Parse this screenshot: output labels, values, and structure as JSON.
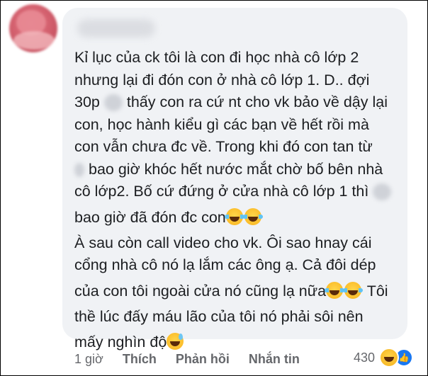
{
  "comment": {
    "lines": [
      "Kỉ lục của ck tôi là con đi học nhà cô lớp 2",
      "nhưng lại đi đón con ở nhà cô lớp 1. D.. đợi",
      "30p",
      "thấy con ra cứ nt cho vk bảo về dậy lại",
      "con, học hành kiểu gì các bạn về hết rồi mà",
      "con vẫn chưa đc về. Trong khi đó con tan từ",
      "bao giờ khóc hết nước mắt chờ bố bên nhà",
      "cô lớp2. Bố cứ đứng ở cửa nhà cô lớp 1 thì",
      "bao giờ đã đón đc con",
      "À sau còn call video cho vk. Ôi sao hnay cái",
      "cổng nhà cô nó lạ lắm các ông ạ. Cả đôi dép",
      "của con tôi ngoài cửa nó cũng lạ nữa",
      "Tôi",
      "thề lúc đấy máu lão của tôi nó phải sôi nên",
      "mấy nghìn độ"
    ]
  },
  "actions": {
    "time": "1 giờ",
    "like": "Thích",
    "reply": "Phản hồi",
    "message": "Nhắn tin"
  },
  "reactions": {
    "count": "430",
    "icons": [
      "haha-icon",
      "like-icon"
    ]
  },
  "colors": {
    "bubble": "#f0f2f5",
    "text": "#1c1e21",
    "meta": "#65676b",
    "like_blue": "#1877f2"
  }
}
